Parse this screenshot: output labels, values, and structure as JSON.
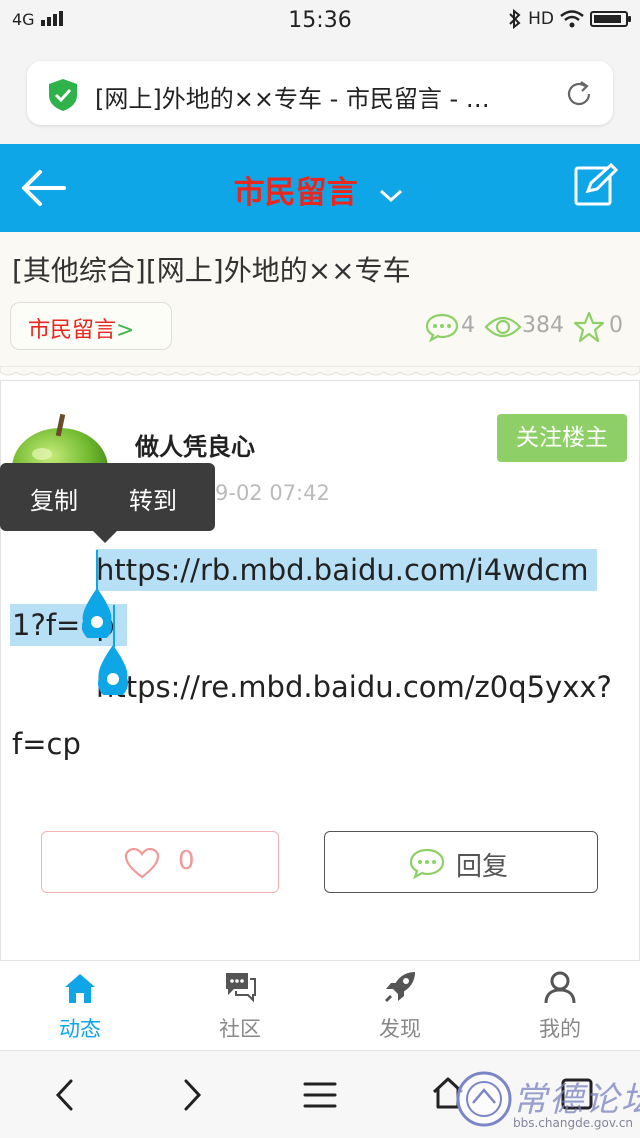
{
  "status_bar": {
    "signal": "4G",
    "time": "15:36",
    "hd": "HD",
    "battery_level": 0.9
  },
  "browser": {
    "url_title": "[网上]外地的××专车 - 市民留言 - …"
  },
  "header": {
    "title": "市民留言"
  },
  "post": {
    "title": "[其他综合][网上]外地的××专车",
    "category": "市民留言",
    "category_arrow": ">",
    "comments": "4",
    "views": "384",
    "favorites": "0"
  },
  "author": {
    "name": "做人凭良心",
    "follow_label": "关注楼主",
    "date": "9-02 07:42"
  },
  "context_menu": {
    "copy": "复制",
    "goto": "转到"
  },
  "content": {
    "line1": "https://rb.mbd.baidu.com/i4wdcm",
    "line2": "1?f=cp",
    "line3": "https://re.mbd.baidu.com/z0q5yxx?",
    "line4": "f=cp"
  },
  "actions": {
    "like_count": "0",
    "reply_label": "回复"
  },
  "tabs": [
    {
      "label": "动态"
    },
    {
      "label": "社区"
    },
    {
      "label": "发现"
    },
    {
      "label": "我的"
    }
  ],
  "watermark": {
    "text": "常德论坛",
    "url": "bbs.changde.gov.cn"
  },
  "colors": {
    "header_bg": "#0fa6e8",
    "title_red": "#e8271f",
    "follow_green": "#8ed067",
    "selection": "#b7dff5"
  }
}
